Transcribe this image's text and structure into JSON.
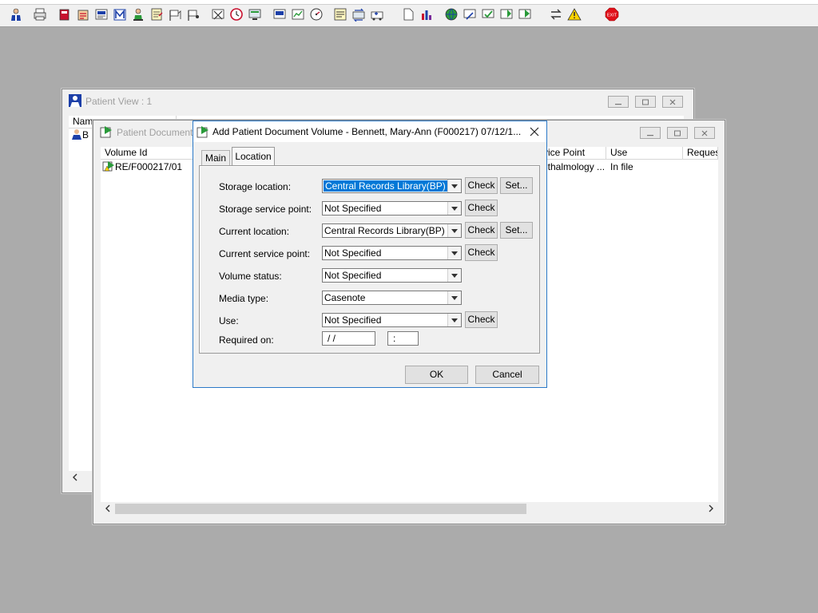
{
  "toolbar": {
    "icons": [
      "patient-icon",
      "print-icon",
      "book-icon",
      "clipboard-icon",
      "report-icon",
      "mail-icon",
      "nurse-icon",
      "notes-icon",
      "flag-icon",
      "flag-icon",
      "scissors-icon",
      "clock-icon",
      "monitor-icon",
      "screen-icon",
      "chart-icon",
      "timer-icon",
      "memo-icon",
      "transfer-icon",
      "ambulance-icon",
      "page-icon",
      "bar-chart-icon",
      "globe-icon",
      "edit-icon",
      "check-icon",
      "refresh-icon",
      "green-check-icon",
      "swap-icon",
      "warning-icon",
      "exit-icon"
    ],
    "exit_label": "EXIT"
  },
  "patient_view": {
    "title": "Patient View : 1",
    "col_name": "Name",
    "row_initial": "B"
  },
  "patient_document": {
    "title": "Patient Document",
    "columns": [
      "Volume Id",
      "vice Point",
      "Use",
      "Reques"
    ],
    "rows": [
      {
        "volume_id": "RE/F000217/01",
        "service_point": "nthalmology ...",
        "use": "In file"
      }
    ]
  },
  "dialog": {
    "title": "Add Patient Document Volume - Bennett, Mary-Ann (F000217) 07/12/1...",
    "tabs": {
      "main": "Main",
      "location": "Location"
    },
    "fields": {
      "storage_location": {
        "label": "Storage location:",
        "value": "Central Records Library(BP)"
      },
      "storage_service_point": {
        "label": "Storage service point:",
        "value": "Not Specified"
      },
      "current_location": {
        "label": "Current location:",
        "value": "Central Records Library(BP)"
      },
      "current_service_point": {
        "label": "Current service point:",
        "value": "Not Specified"
      },
      "volume_status": {
        "label": "Volume status:",
        "value": "Not Specified"
      },
      "media_type": {
        "label": "Media type:",
        "value": "Casenote"
      },
      "use": {
        "label": "Use:",
        "value": "Not Specified"
      },
      "required_on": {
        "label": "Required on:",
        "date": " /  /",
        "time": " :"
      }
    },
    "check_label": "Check",
    "set_label": "Set...",
    "ok_label": "OK",
    "cancel_label": "Cancel"
  },
  "colors": {
    "selection": "#0078d7",
    "dialog_border": "#2b79c8",
    "desktop": "#ababab"
  }
}
